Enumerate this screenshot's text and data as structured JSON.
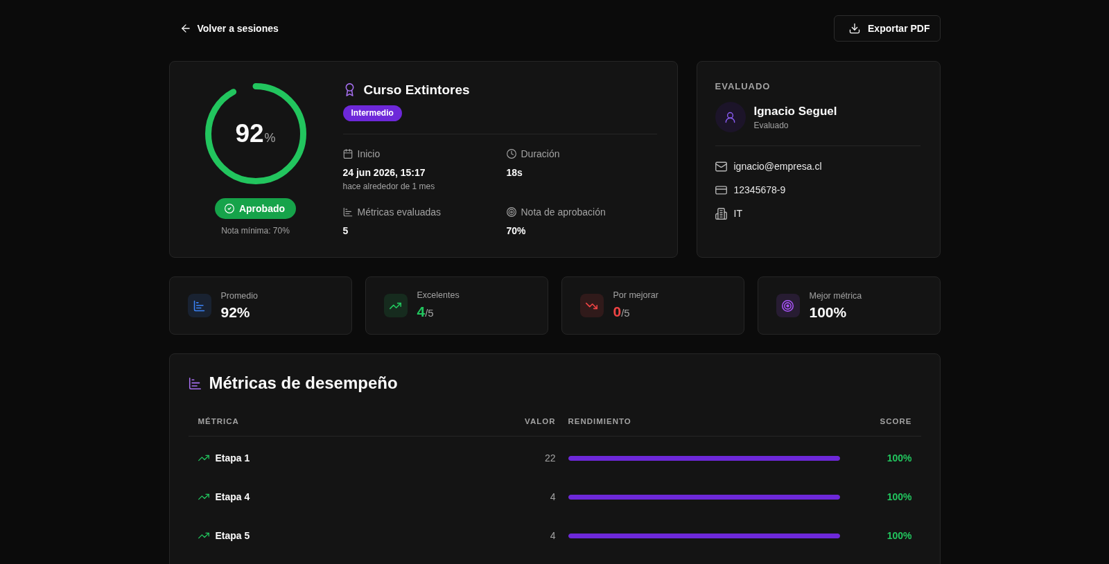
{
  "header": {
    "back_link": "Volver a sesiones",
    "export_button": "Exportar PDF"
  },
  "session": {
    "score": {
      "value": "92",
      "unit": "%",
      "level": 0.92
    },
    "status": {
      "label": "Aprobado",
      "passed": true
    },
    "minimum": "Nota mínima: 70%",
    "title": "Curso Extintores",
    "difficulty": "Intermedio",
    "details": [
      {
        "kind": "calendar",
        "label": "Inicio",
        "value": "24 jun 2026, 15:17",
        "note": "hace alrededor de 1 mes"
      },
      {
        "kind": "clock",
        "label": "Duración",
        "value": "18s"
      },
      {
        "kind": "metrics",
        "label": "Métricas evaluadas",
        "value": "5"
      },
      {
        "kind": "target",
        "label": "Nota de aprobación",
        "value": "70%"
      }
    ]
  },
  "evaluee": {
    "heading": "EVALUADO",
    "name": "Ignacio Seguel",
    "role": "Evaluado",
    "info": [
      {
        "kind": "mail",
        "text": "ignacio@empresa.cl"
      },
      {
        "kind": "id_card",
        "text": "12345678-9"
      },
      {
        "kind": "building",
        "text": "IT"
      }
    ]
  },
  "stats": [
    {
      "kind": "chart",
      "label": "Promedio",
      "value": "92%",
      "color": "#3b82f6",
      "tinted": false
    },
    {
      "kind": "trend_up",
      "label": "Excelentes",
      "value": "4",
      "total": "/5",
      "color": "#22c55e",
      "tinted": true
    },
    {
      "kind": "trend_down",
      "label": "Por mejorar",
      "value": "0",
      "total": "/5",
      "color": "#ef4444",
      "tinted": true
    },
    {
      "kind": "target",
      "label": "Mejor métrica",
      "value": "100%",
      "color": "#a855f7",
      "tinted": false
    }
  ],
  "metrics": {
    "title": "Métricas de desempeño",
    "columns": [
      "MÉTRICA",
      "VALOR",
      "RENDIMIENTO",
      "SCORE"
    ],
    "rows": [
      {
        "kind": "excellent",
        "name": "Etapa 1",
        "value": "22",
        "level": 1,
        "score": "100%"
      },
      {
        "kind": "excellent",
        "name": "Etapa 4",
        "value": "4",
        "level": 1,
        "score": "100%"
      },
      {
        "kind": "excellent",
        "name": "Etapa 5",
        "value": "4",
        "level": 1,
        "score": "100%"
      }
    ]
  }
}
